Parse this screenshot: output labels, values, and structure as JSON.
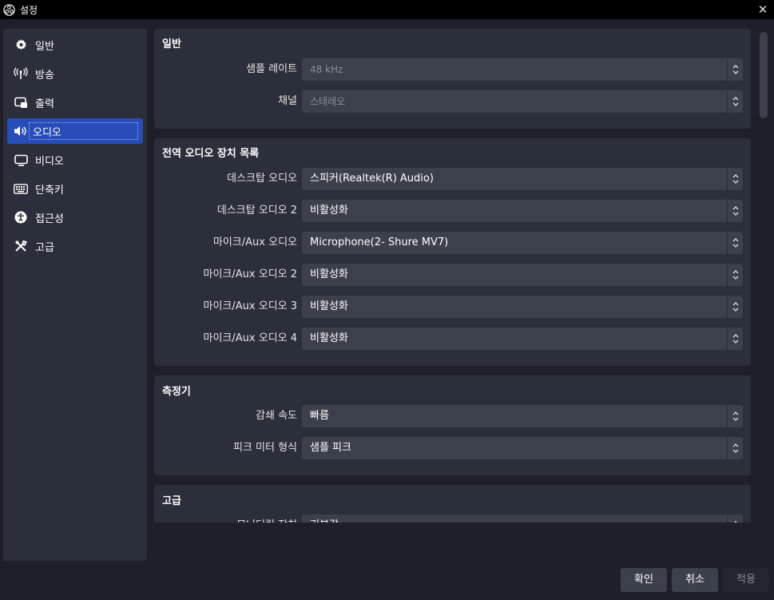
{
  "window": {
    "title": "설정"
  },
  "sidebar": {
    "items": [
      {
        "label": "일반",
        "icon": "gear-icon"
      },
      {
        "label": "방송",
        "icon": "broadcast-antenna-icon"
      },
      {
        "label": "출력",
        "icon": "output-monitor-icon"
      },
      {
        "label": "오디오",
        "icon": "speaker-icon",
        "active": true
      },
      {
        "label": "비디오",
        "icon": "monitor-icon"
      },
      {
        "label": "단축키",
        "icon": "keyboard-icon"
      },
      {
        "label": "접근성",
        "icon": "accessibility-icon"
      },
      {
        "label": "고급",
        "icon": "tools-icon"
      }
    ]
  },
  "general": {
    "title": "일반",
    "sample_rate_label": "샘플 레이트",
    "sample_rate_value": "48 kHz",
    "channel_label": "채널",
    "channel_value": "스테레오"
  },
  "devices": {
    "title": "전역 오디오 장치 목록",
    "rows": [
      {
        "label": "데스크탑 오디오",
        "value": "스피커(Realtek(R) Audio)"
      },
      {
        "label": "데스크탑 오디오 2",
        "value": "비활성화"
      },
      {
        "label": "마이크/Aux 오디오",
        "value": "Microphone(2- Shure MV7)"
      },
      {
        "label": "마이크/Aux 오디오 2",
        "value": "비활성화"
      },
      {
        "label": "마이크/Aux 오디오 3",
        "value": "비활성화"
      },
      {
        "label": "마이크/Aux 오디오 4",
        "value": "비활성화"
      }
    ]
  },
  "meters": {
    "title": "측정기",
    "decay_label": "감쇄 속도",
    "decay_value": "빠름",
    "peak_label": "피크 미터 형식",
    "peak_value": "샘플 피크"
  },
  "advanced": {
    "title": "고급",
    "monitoring_label": "모니터링 장치",
    "monitoring_value": "기본값"
  },
  "buttons": {
    "ok": "확인",
    "cancel": "취소",
    "apply": "적용"
  },
  "colors": {
    "accent": "#284cb8",
    "background": "#1e1f29",
    "panel": "#2b2e3b",
    "field": "#3c404d"
  }
}
